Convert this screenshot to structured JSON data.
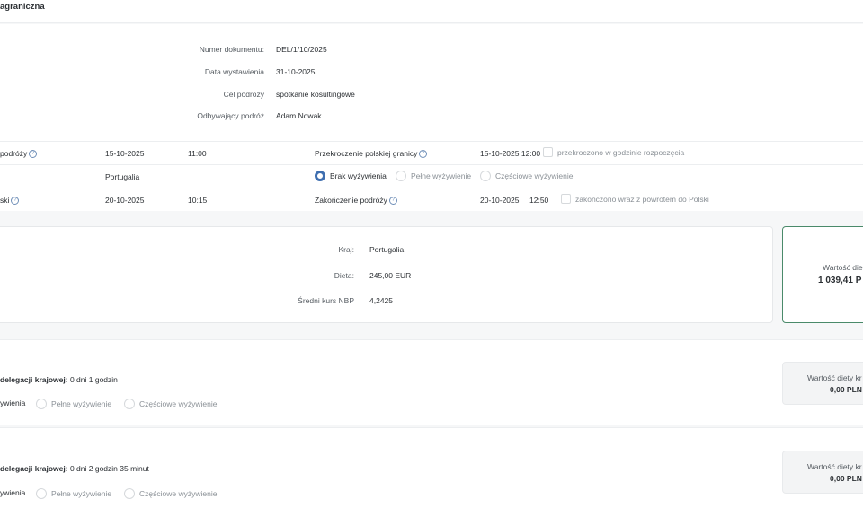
{
  "header": {
    "title": "agraniczna"
  },
  "document": {
    "number_label": "Numer dokumentu:",
    "number_value": "DEL/1/10/2025",
    "date_label": "Data wystawienia",
    "date_value": "31-10-2025",
    "purpose_label": "Cel podróży",
    "purpose_value": "spotkanie kosultingowe",
    "traveler_label": "Odbywający podróż",
    "traveler_value": "Adam Nowak"
  },
  "trip": {
    "row1": {
      "label": "podróży",
      "date": "15-10-2025",
      "time": "11:00",
      "border_label": "Przekroczenie polskiej granicy",
      "border_datetime": "15-10-2025 12:00",
      "check_label": "przekroczono w godzinie rozpoczęcia"
    },
    "row2": {
      "country": "Portugalia",
      "opt_none": "Brak wyżywienia",
      "opt_full": "Pełne wyżywienie",
      "opt_partial": "Częściowe wyżywienie"
    },
    "row3": {
      "label": "ski",
      "date": "20-10-2025",
      "time": "10:15",
      "end_label": "Zakończenie podróży",
      "end_date": "20-10-2025",
      "end_time": "12:50",
      "check_label": "zakończono wraz z powrotem do Polski"
    }
  },
  "summary": {
    "country_label": "Kraj:",
    "country_value": "Portugalia",
    "diet_label": "Dieta:",
    "diet_value": "245,00 EUR",
    "rate_label": "Średni kurs NBP",
    "rate_value": "4,2425",
    "value_label": "Wartość die",
    "value_amount": "1 039,41 P"
  },
  "domestic1": {
    "title_prefix": "delegacji krajowej:",
    "title_value": "0 dni 1 godzin",
    "opt_none": "ywienia",
    "opt_full": "Pełne wyżywienie",
    "opt_partial": "Częściowe wyżywienie",
    "value_label": "Wartość diety kr",
    "value_amount": "0,00 PLN"
  },
  "domestic2": {
    "title_prefix": "delegacji krajowej:",
    "title_value": "0 dni 2 godzin 35 minut",
    "opt_none": "ywienia",
    "opt_full": "Pełne wyżywienie",
    "opt_partial": "Częściowe wyżywienie",
    "value_label": "Wartość diety kr",
    "value_amount": "0,00 PLN"
  }
}
